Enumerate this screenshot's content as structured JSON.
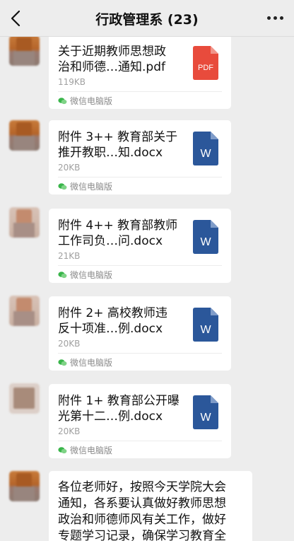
{
  "header": {
    "title": "行政管理系 (23)"
  },
  "messages": [
    {
      "file_name": "关于近期教师思想政\n治和师德…通知.pdf",
      "file_size": "119KB",
      "file_type": "PDF",
      "icon_color": "#e84b3c",
      "source": "微信电脑版"
    },
    {
      "file_name": "附件 3++ 教育部关于\n推开教职…知.docx",
      "file_size": "20KB",
      "file_type": "W",
      "icon_color": "#2b579a",
      "source": "微信电脑版"
    },
    {
      "file_name": "附件 4++ 教育部教师\n工作司负…问.docx",
      "file_size": "21KB",
      "file_type": "W",
      "icon_color": "#2b579a",
      "source": "微信电脑版"
    },
    {
      "file_name": "附件 2+ 高校教师违\n反十项准…例.docx",
      "file_size": "20KB",
      "file_type": "W",
      "icon_color": "#2b579a",
      "source": "微信电脑版"
    },
    {
      "file_name": "附件 1+ 教育部公开曝\n光第十二…例.docx",
      "file_size": "20KB",
      "file_type": "W",
      "icon_color": "#2b579a",
      "source": "微信电脑版"
    }
  ],
  "text_message": {
    "content": "各位老师好，按照今天学院大会\n通知，各系要认真做好教师思想\n政治和师德师风有关工作，做好\n专题学习记录，确保学习教育全"
  }
}
